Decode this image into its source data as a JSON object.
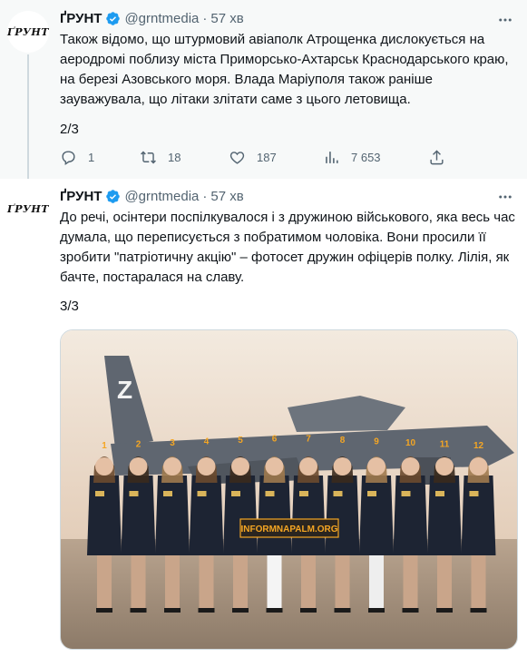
{
  "tweets": [
    {
      "avatar_text": "ҐРУНТ",
      "name": "ҐРУНТ",
      "handle": "@grntmedia",
      "separator": "·",
      "time": "57 хв",
      "text": "Також відомо, що штурмовий авіаполк Атрощенка дислокується на аеродромі поблизу міста Приморсько-Ахтарськ Краснодарського краю, на березі Азовського моря. Влада Маріуполя також раніше зауважувала, що літаки злітати саме з цього летовища.",
      "counter": "2/3",
      "actions": {
        "reply": {
          "icon": "reply-icon",
          "count": "1"
        },
        "retweet": {
          "icon": "retweet-icon",
          "count": "18"
        },
        "like": {
          "icon": "like-icon",
          "count": "187"
        },
        "views": {
          "icon": "views-icon",
          "count": "7 653"
        },
        "share": {
          "icon": "share-icon",
          "count": ""
        }
      }
    },
    {
      "avatar_text": "ҐРУНТ",
      "name": "ҐРУНТ",
      "handle": "@grntmedia",
      "separator": "·",
      "time": "57 хв",
      "text": "До речі, осінтери поспілкувалося і з дружиною військового, яка весь час думала, що переписується з побратимом чоловіка. Вони просили її зробити \"патріотичну акцію\" – фотосет дружин офіцерів полку. Лілія, як бачте, постаралася на славу.",
      "counter": "3/3",
      "photo": {
        "tail_letter": "Z",
        "watermark": "INFORMNAPALM.ORG",
        "labels": [
          "1",
          "2",
          "3",
          "4",
          "5",
          "6",
          "7",
          "8",
          "9",
          "10",
          "11",
          "12"
        ]
      }
    }
  ],
  "colors": {
    "secondary_text": "#536471",
    "verified_blue": "#1d9bf0",
    "label_orange": "#f5a623",
    "thread_bg": "#f7f9f9"
  }
}
